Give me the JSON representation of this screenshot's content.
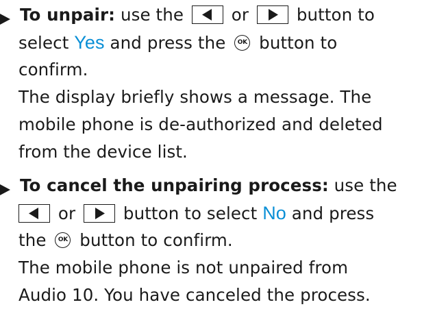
{
  "icons": {
    "left_button": "left-arrow-button-icon",
    "right_button": "right-arrow-button-icon",
    "ok_button": "ok-button-icon",
    "bullet": "bullet-triangle-icon"
  },
  "colors": {
    "highlight": "#0a8fd6",
    "text": "#1a1a1a"
  },
  "unpair": {
    "lead": "To unpair:",
    "t1": " use the ",
    "t2": " or ",
    "t3": " button to",
    "t4": "select ",
    "option": "Yes",
    "t5": " and press the ",
    "ok_label": "OK",
    "t6": " button to",
    "t7": "confirm.",
    "result_1": "The display briefly shows a message. The",
    "result_2": "mobile phone is de-authorized and deleted",
    "result_3": "from the device list."
  },
  "cancel": {
    "lead": "To cancel the unpairing process:",
    "t1": " use the",
    "t2": " or ",
    "t3": " button to select ",
    "option": "No",
    "t4": " and press",
    "t5": "the ",
    "ok_label": "OK",
    "t6": " button to confirm.",
    "result_1": "The mobile phone is not unpaired from",
    "result_2": "Audio 10. You have canceled the process."
  }
}
